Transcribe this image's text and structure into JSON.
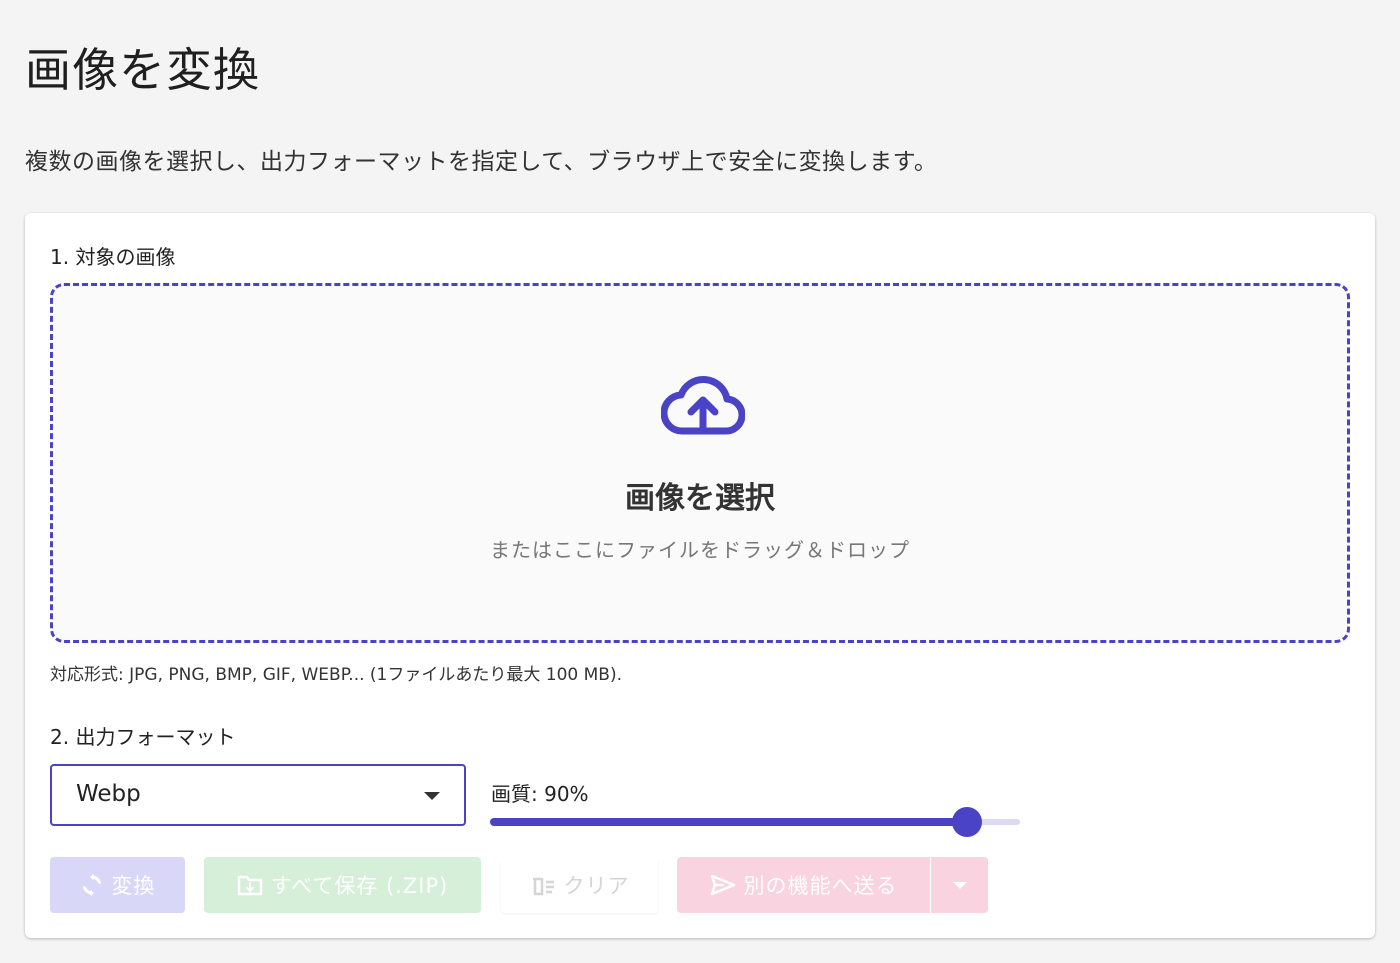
{
  "page": {
    "title": "画像を変換",
    "subtitle": "複数の画像を選択し、出力フォーマットを指定して、ブラウザ上で安全に変換します。"
  },
  "step1": {
    "label": "1. 対象の画像",
    "dropzone": {
      "icon": "cloud-upload-icon",
      "title": "画像を選択",
      "hint": "またはここにファイルをドラッグ＆ドロップ"
    },
    "formats_note": "対応形式: JPG, PNG, BMP, GIF, WEBP... (1ファイルあたり最大 100 MB)."
  },
  "step2": {
    "label": "2. 出力フォーマット",
    "format_select": {
      "value": "Webp"
    },
    "quality": {
      "label": "画質: 90%",
      "value": 90,
      "max": 100
    }
  },
  "actions": {
    "convert": {
      "label": "変換",
      "icon": "refresh-icon",
      "enabled": false
    },
    "save_zip": {
      "label": "すべて保存 (.ZIP)",
      "icon": "folder-icon",
      "enabled": false
    },
    "clear": {
      "label": "クリア",
      "icon": "trash-icon",
      "enabled": false
    },
    "send": {
      "label": "別の機能へ送る",
      "icon": "send-icon",
      "enabled": false
    }
  },
  "colors": {
    "accent": "#4a43c5",
    "convert_disabled": "#d9d7f8",
    "zip_disabled": "#d6efd9",
    "send_disabled": "#f9d3df"
  }
}
